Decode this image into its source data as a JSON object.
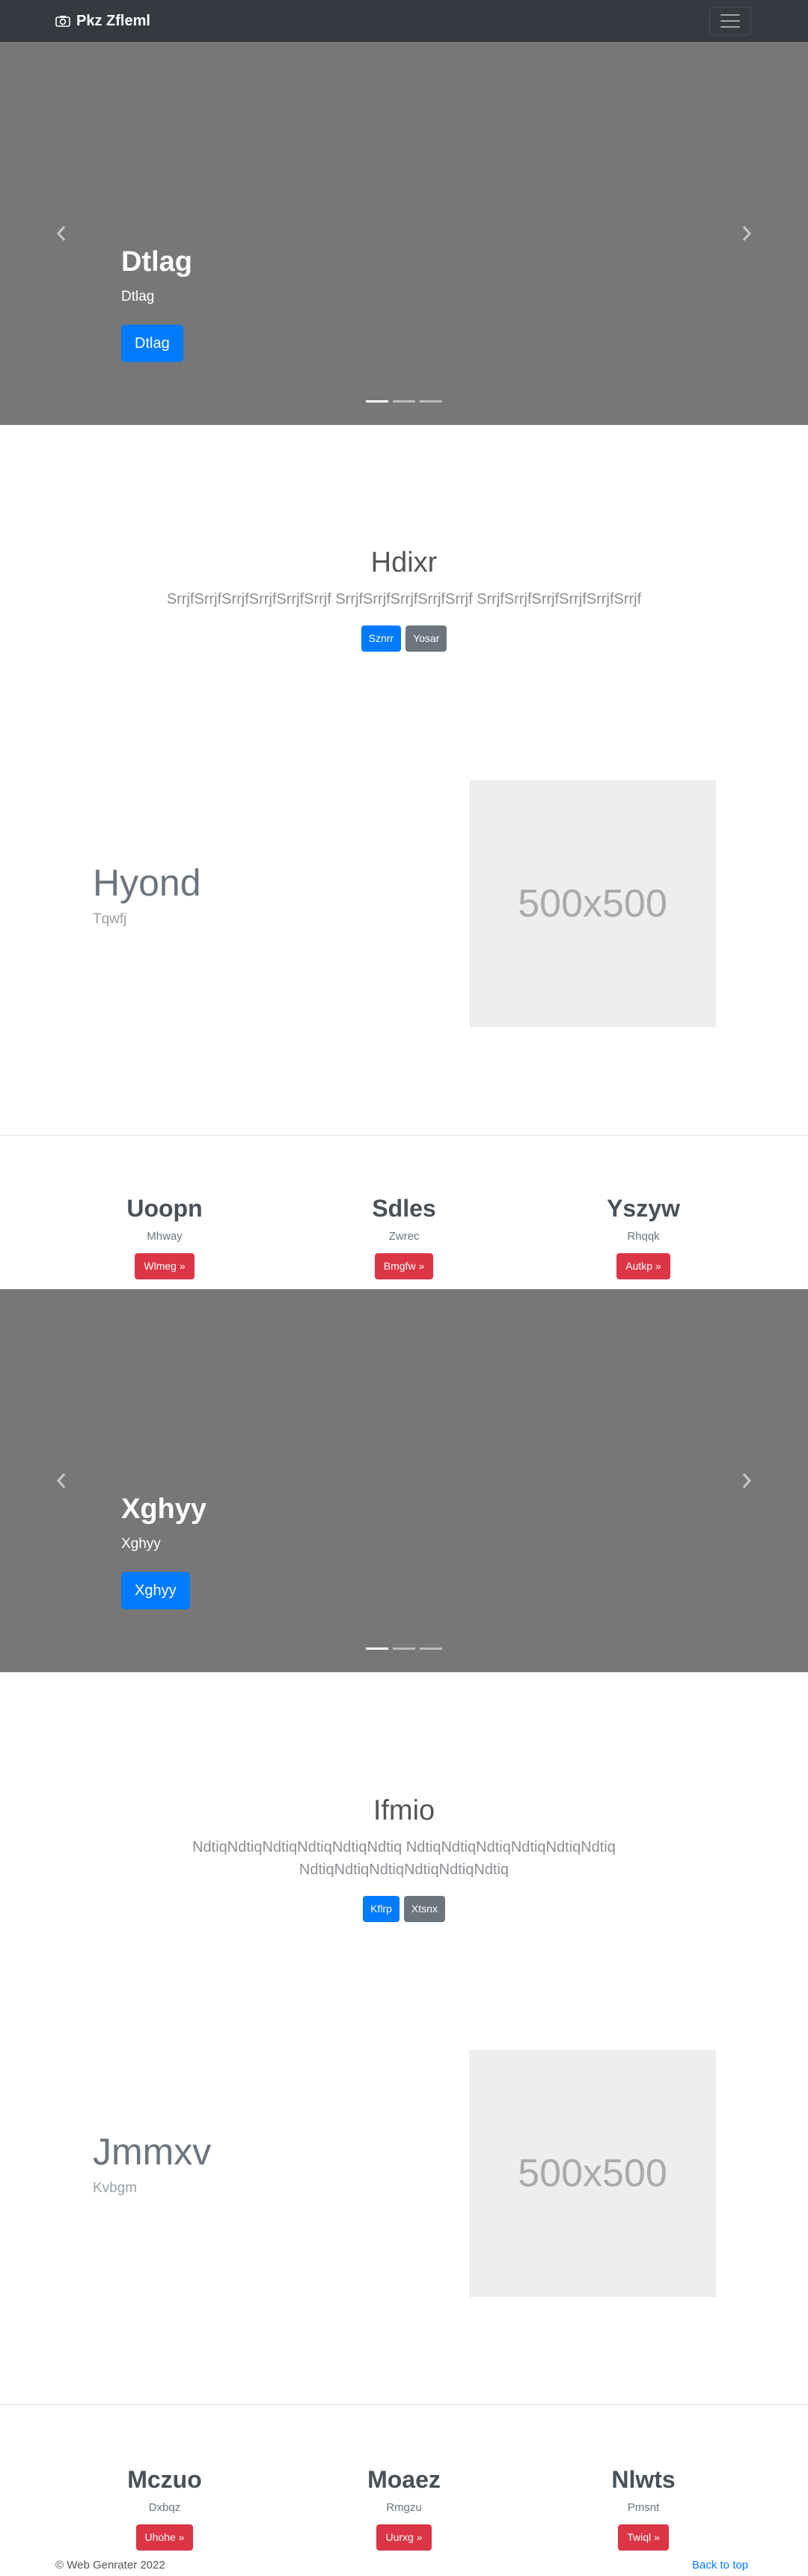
{
  "navbar": {
    "brand": "Pkz Zfleml",
    "brand_icon": "camera-icon",
    "toggler_icon": "hamburger-icon"
  },
  "carousel1": {
    "title": "Dtlag",
    "subtitle": "Dtlag",
    "button": "Dtlag",
    "slides_count": 3,
    "active_slide": 1
  },
  "jumbotron1": {
    "title": "Hdixr",
    "lead": "SrrjfSrrjfSrrjfSrrjfSrrjfSrrjf SrrjfSrrjfSrrjfSrrjfSrrjf SrrjfSrrjfSrrjfSrrjfSrrjfSrrjf",
    "primary_button": "Sznrr",
    "secondary_button": "Yosar"
  },
  "feature1": {
    "title": "Hyond",
    "subtitle": "Tqwfj",
    "placeholder": "500x500"
  },
  "columns1": [
    {
      "title": "Uoopn",
      "text": "Mhway",
      "button": "Wlmeg »"
    },
    {
      "title": "Sdles",
      "text": "Zwrec",
      "button": "Bmgfw »"
    },
    {
      "title": "Yszyw",
      "text": "Rhqqk",
      "button": "Autkp »"
    }
  ],
  "carousel2": {
    "title": "Xghyy",
    "subtitle": "Xghyy",
    "button": "Xghyy",
    "slides_count": 3,
    "active_slide": 1
  },
  "jumbotron2": {
    "title": "Ifmio",
    "lead": "NdtiqNdtiqNdtiqNdtiqNdtiqNdtiq NdtiqNdtiqNdtiqNdtiqNdtiqNdtiq NdtiqNdtiqNdtiqNdtiqNdtiqNdtiq",
    "primary_button": "Kflrp",
    "secondary_button": "Xtsnx"
  },
  "feature2": {
    "title": "Jmmxv",
    "subtitle": "Kvbgm",
    "placeholder": "500x500"
  },
  "columns2": [
    {
      "title": "Mczuo",
      "text": "Dxbqz",
      "button": "Uhohe »"
    },
    {
      "title": "Moaez",
      "text": "Rmgzu",
      "button": "Uurxg »"
    },
    {
      "title": "Nlwts",
      "text": "Pmsnt",
      "button": "Twiql »"
    }
  ],
  "footer": {
    "copyright": "© Web Genrater 2022",
    "back_to_top": "Back to top"
  },
  "colors": {
    "navbar": "#343a40",
    "carousel_bg": "#777777",
    "primary": "#007bff",
    "secondary": "#6c757d",
    "danger": "#dc3545",
    "placeholder_bg": "#eeeeee"
  }
}
